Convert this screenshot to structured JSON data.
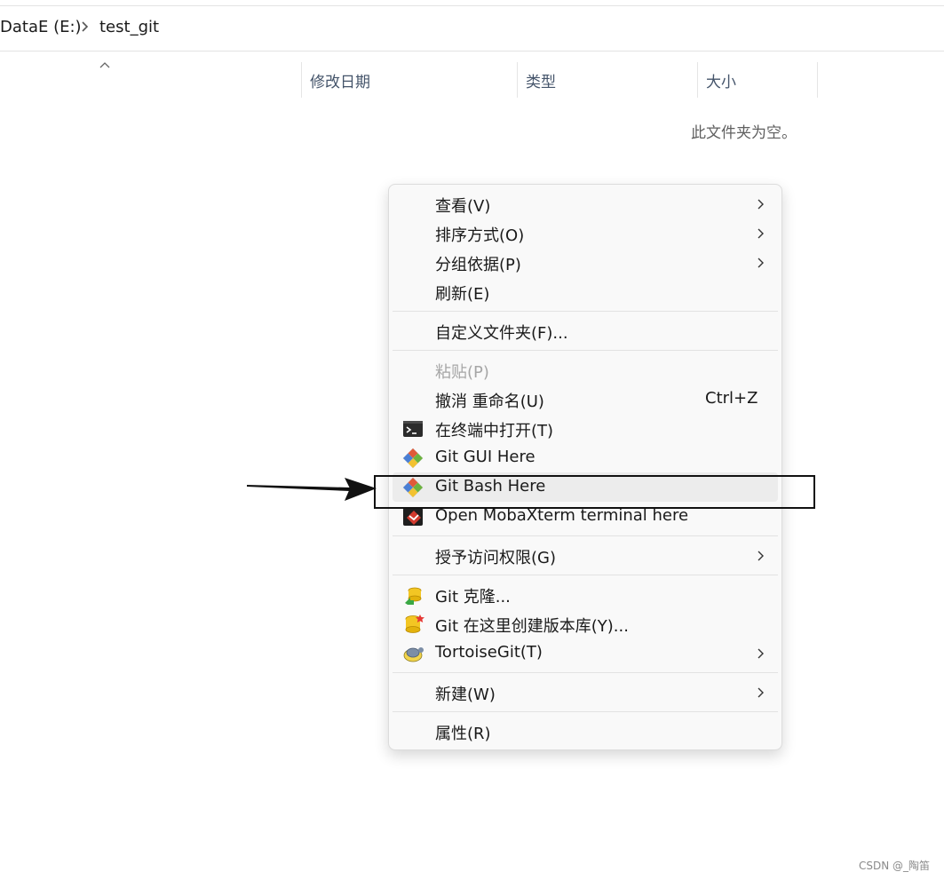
{
  "breadcrumb": {
    "drive": "DataE (E:)",
    "folder": "test_git"
  },
  "columns": [
    "修改日期",
    "类型",
    "大小"
  ],
  "empty_message": "此文件夹为空。",
  "menu": {
    "view": "查看(V)",
    "sort": "排序方式(O)",
    "group": "分组依据(P)",
    "refresh": "刷新(E)",
    "customize": "自定义文件夹(F)...",
    "paste": "粘贴(P)",
    "undo": "撤消 重命名(U)",
    "undo_shortcut": "Ctrl+Z",
    "terminal": "在终端中打开(T)",
    "git_gui": "Git GUI Here",
    "git_bash": "Git Bash Here",
    "mobaxterm": "Open MobaXterm terminal here",
    "grant_access": "授予访问权限(G)",
    "git_clone": "Git 克隆...",
    "git_create_repo": "Git 在这里创建版本库(Y)...",
    "tortoisegit": "TortoiseGit(T)",
    "new": "新建(W)",
    "properties": "属性(R)"
  },
  "icons": {
    "terminal": "terminal-icon",
    "git": "git-diamond-icon",
    "mobaxterm": "mobaxterm-icon",
    "clone": "git-clone-icon",
    "create_repo": "git-create-repo-icon",
    "tortoisegit": "tortoisegit-icon"
  },
  "watermark": "CSDN @_陶笛"
}
